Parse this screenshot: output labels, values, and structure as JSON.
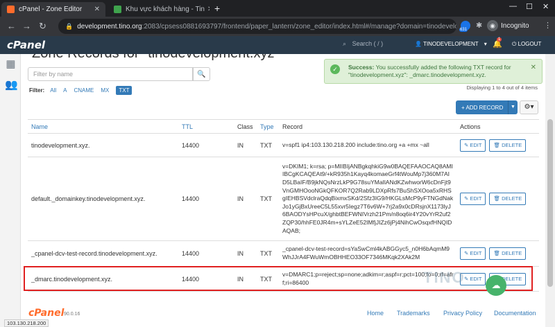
{
  "browser": {
    "tabs": [
      {
        "title": "cPanel - Zone Editor",
        "active": true
      },
      {
        "title": "Khu vực khách hàng - Tin",
        "active": false
      }
    ],
    "new_tab": "+",
    "url_host": "development.tino.org",
    "url_rest": ":2083/cpsess0881693797/frontend/paper_lantern/zone_editor/index.html#/manage?domain=tinodevelo...",
    "ext_badge": "631",
    "incognito_label": "Incognito"
  },
  "header": {
    "logo": "cPanel",
    "search_placeholder": "Search ( / )",
    "user": "TINODEVELOPMENT",
    "notification_count": "1",
    "logout": "LOGOUT"
  },
  "page": {
    "title": "Zone Records for \"tinodevelopment.xyz\"",
    "filter_placeholder": "Filter by name",
    "filter_label": "Filter:",
    "filters": [
      "All",
      "A",
      "CNAME",
      "MX",
      "TXT"
    ],
    "selected_filter": "TXT"
  },
  "alert": {
    "strong": "Success:",
    "text": "You successfully added the following TXT record for \"tinodevelopment.xyz\": _dmarc.tinodevelopment.xyz."
  },
  "displaying": "Displaying 1 to 4 out of 4 items",
  "toolbar": {
    "add_record": "+ ADD RECORD"
  },
  "table": {
    "headers": [
      "Name",
      "TTL",
      "Class",
      "Type",
      "Record",
      "Actions"
    ],
    "edit_label": "EDIT",
    "delete_label": "DELETE",
    "rows": [
      {
        "name": "tinodevelopment.xyz.",
        "ttl": "14400",
        "class": "IN",
        "type": "TXT",
        "record": "v=spf1 ip4:103.130.218.200 include:tino.org +a +mx ~all"
      },
      {
        "name": "default._domainkey.tinodevelopment.xyz.",
        "ttl": "14400",
        "class": "IN",
        "type": "TXT",
        "record": "v=DKIM1; k=rsa; p=MIIBIjANBgkqhkiG9w0BAQEFAAOCAQ8AMIIBCgKCAQEAt9/+kR935h1Kayq4komaeGrf4tWouMp7j360M7AID5LBaIF/B9jkNQsNrzLkP9G78suYMaIlANdKZwhworW6cDnFjt9VnGMHOooNGkQFKOR7Q2Rab9LDXpRfs7BuShSXOoa5xRHSgIEHBSVdclraQdqBixmxSKd/2Sfz3IG9/HKGLsMcP9yFTNGdNakJo1yGjBxUreeC5L55xvr5Iegz7T6v6W+7rj2a9x0cDRsjnX1173lyJ6BAODYsHPcuX/ghbtBEFWNIVrzh21Pm/n8oq6ir4Y20vYrR2uf2ZQP30/hhFE0JR4m+sYLZeE52IMfjJIZz6jPj4NihCwOsqxfHNQIDAQAB;"
      },
      {
        "name": "_cpanel-dcv-test-record.tinodevelopment.xyz.",
        "ttl": "14400",
        "class": "IN",
        "type": "TXT",
        "record": "_cpanel-dcv-test-record=sYaSwCml4kABGGyc5_n0H6bAqmM9WhJJrA4FWuWmOBHHEO33OF7346MKqk2XAk2M"
      },
      {
        "name": "_dmarc.tinodevelopment.xyz.",
        "ttl": "14400",
        "class": "IN",
        "type": "TXT",
        "record": "v=DMARC1;p=reject;sp=none;adkim=r;aspf=r;pct=100;fo=0;rf=afrf;ri=86400"
      }
    ]
  },
  "footer": {
    "logo": "cPanel",
    "version": "90.0.16",
    "links": [
      "Home",
      "Trademarks",
      "Privacy Policy",
      "Documentation"
    ]
  },
  "status_url": "103.130.218.200",
  "watermark": "TINO"
}
